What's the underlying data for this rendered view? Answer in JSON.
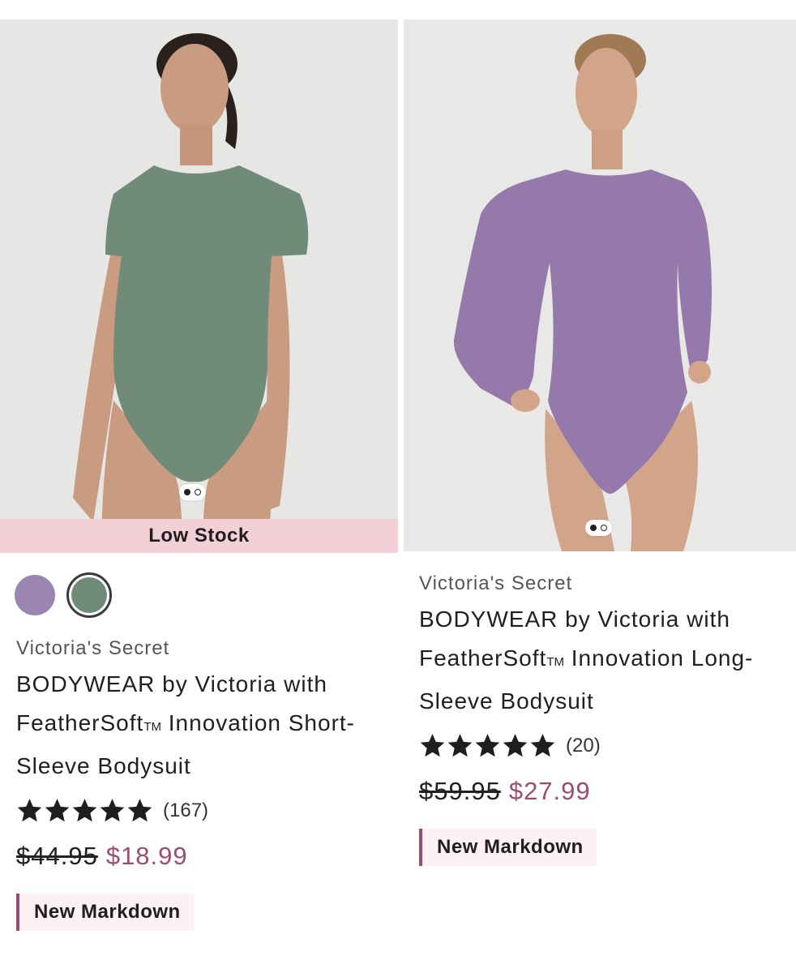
{
  "products": [
    {
      "badge_overlay": "Low Stock",
      "image_icon": "model-green-short-sleeve-bodysuit",
      "swatches": [
        "#9a86b0",
        "#6f8b78"
      ],
      "brand": "Victoria's Secret",
      "title_part1": "BODYWEAR by Victoria with FeatherSoft",
      "title_tm": "TM",
      "title_part2": " Innovation Short-Sleeve Bodysuit",
      "rating_count": "(167)",
      "stars": 5,
      "price_original": "$44.95",
      "price_sale": "$18.99",
      "tag": "New Markdown"
    },
    {
      "image_icon": "model-purple-long-sleeve-bodysuit",
      "brand": "Victoria's Secret",
      "title_part1": "BODYWEAR by Victoria with FeatherSoft",
      "title_tm": "TM",
      "title_part2": " Innovation Long-Sleeve Bodysuit",
      "rating_count": "(20)",
      "stars": 5,
      "price_original": "$59.95",
      "price_sale": "$27.99",
      "tag": "New Markdown"
    }
  ],
  "colors": {
    "sale": "#9a4d72",
    "low_stock_bg": "#f3cfd8",
    "tag_bg": "#fdf1f3"
  }
}
